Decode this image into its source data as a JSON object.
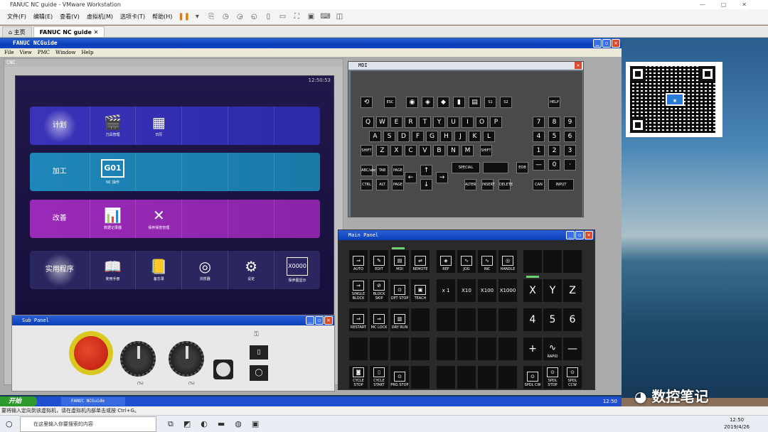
{
  "vmware": {
    "title": "FANUC NC guide - VMware Workstation",
    "menu": [
      "文件(F)",
      "编辑(E)",
      "查看(V)",
      "虚拟机(M)",
      "选项卡(T)",
      "帮助(H)"
    ],
    "tabs": [
      "主页",
      "FANUC NC guide"
    ],
    "status": "要将输入定向到该虚拟机，请在虚拟机内部单击或按 Ctrl+G。"
  },
  "ncguide": {
    "title": "FANUC NCGuide",
    "menu": [
      "File",
      "View",
      "PMC",
      "Window",
      "Help"
    ],
    "cnc_label": "CNC",
    "clock": "12:50:53",
    "rows": [
      {
        "category": "计划",
        "items": [
          "刀具管理",
          "日历"
        ]
      },
      {
        "category": "加工",
        "items": [
          "NC 操作"
        ]
      },
      {
        "category": "改善",
        "items": [
          "数据记录器",
          "保养保管管理"
        ]
      },
      {
        "category": "实用程序",
        "items": [
          "使用手册",
          "备忘录",
          "浏览器",
          "设定",
          "保养图显示"
        ]
      }
    ]
  },
  "mdi": {
    "title": "MDI",
    "keys": {
      "esc": "ESC",
      "s1": "S1",
      "s2": "S2",
      "help": "HELP",
      "row1": [
        "Q",
        "W",
        "E",
        "R",
        "T",
        "Y",
        "U",
        "I",
        "O",
        "P"
      ],
      "row2": [
        "A",
        "S",
        "D",
        "F",
        "G",
        "H",
        "J",
        "K",
        "L"
      ],
      "row3": [
        "Z",
        "X",
        "C",
        "V",
        "B",
        "N",
        "M"
      ],
      "shift": "SHIFT",
      "num1": [
        "7",
        "8",
        "9"
      ],
      "num2": [
        "4",
        "5",
        "6"
      ],
      "num3": [
        "1",
        "2",
        "3"
      ],
      "minus": "—",
      "zero": "0",
      "dot": "·",
      "abc": "ABC/abc",
      "tab": "TAB",
      "page_up": "PAGE",
      "page_down": "PAGE",
      "special": "SPECIAL",
      "eob": "EOB",
      "ctrl": "CTRL",
      "alt": "ALT",
      "alter": "ALTER",
      "insert": "INSERT",
      "delete": "DELETE",
      "can": "CAN",
      "input": "INPUT"
    }
  },
  "main_panel": {
    "title": "Main Panel",
    "modes": [
      "AUTO",
      "EDIT",
      "MDI",
      "REMOTE"
    ],
    "manual": [
      "REF",
      "JOG",
      "INC",
      "HANDLE"
    ],
    "func": [
      "SINGLE BLOCK",
      "BLOCK SKIP",
      "OPT STOP",
      "TEACH"
    ],
    "incr": [
      "x 1",
      "X10",
      "X100",
      "X1000"
    ],
    "axes": [
      "X",
      "Y",
      "Z"
    ],
    "nums": [
      "4",
      "5",
      "6"
    ],
    "func2": [
      "RESTART",
      "MC LOCK",
      "DRY RUN"
    ],
    "rapid": [
      "+",
      "RAPID",
      "—"
    ],
    "cycle": [
      "CYCLE STOP",
      "CYCLE START",
      "PRG STOP"
    ],
    "spindle": [
      "SPDL CW",
      "SPDL STOP",
      "SPDL CCW"
    ]
  },
  "sub_panel": {
    "title": "Sub Panel",
    "pct1": "(%)",
    "pct2": "(%)"
  },
  "guest_taskbar": {
    "start": "开始",
    "item": "FANUC NCGuide",
    "time": "12:50"
  },
  "win_taskbar": {
    "search": "在这里输入你要搜索的内容",
    "time": "12:50",
    "date": "2019/4/26"
  },
  "watermark": "数控笔记"
}
